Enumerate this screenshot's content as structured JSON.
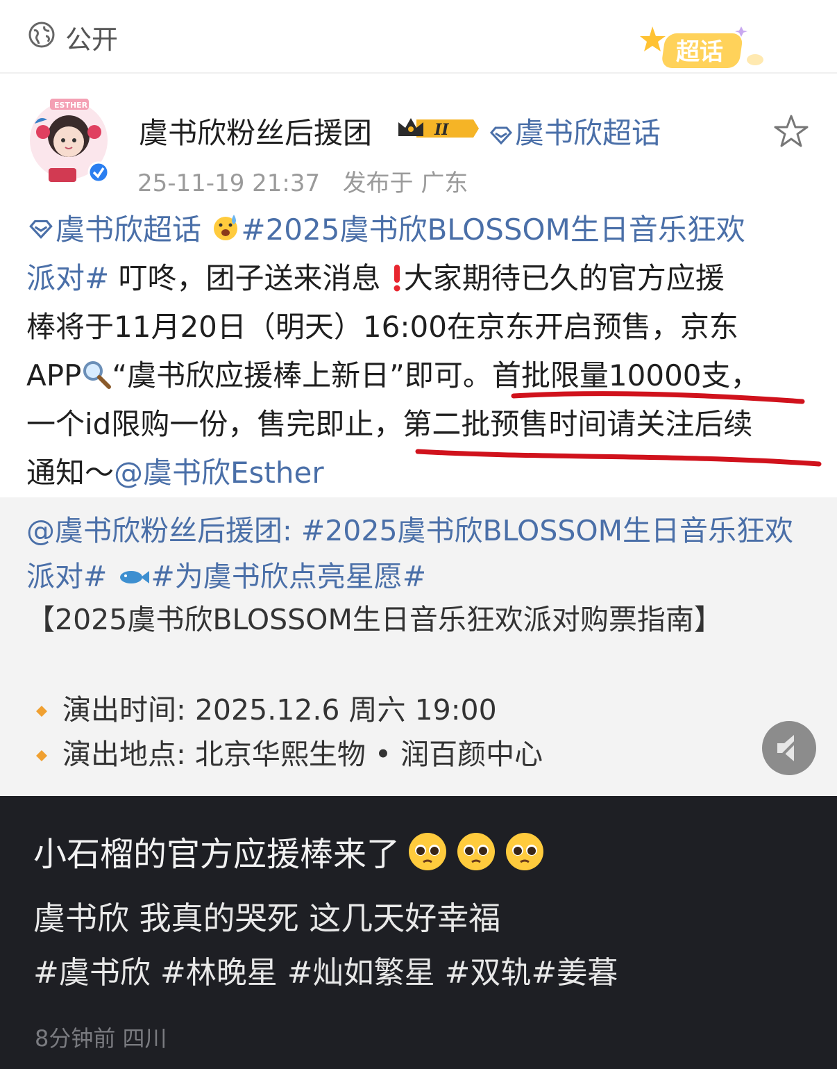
{
  "topbar": {
    "visibility": "公开",
    "badge_text": "超话"
  },
  "post": {
    "author": "虞书欣粉丝后援团",
    "level_badge": "II",
    "topic": "虞书欣超话",
    "timestamp": "25-11-19 21:37",
    "location": "发布于 广东",
    "avatar_text": "ESTHER",
    "body_lines": [
      {
        "a": "虞书欣超话",
        "b": "#2025虞书欣BLOSSOM生日音乐狂欢"
      },
      {
        "a": "派对#",
        "b": " 叮咚，团子送来消息",
        "c": "大家期待已久的官方应援"
      },
      {
        "a": "棒将于11月20日（明天）16:00在京东开启预售，京东"
      },
      {
        "a": "APP",
        "b": "“虞书欣应援棒上新日”即可。首批限量10000支，"
      },
      {
        "a": "一个id限购一份，售完即止，第二批预售时间请关注后续"
      },
      {
        "a": "通知～",
        "b": "@虞书欣Esther"
      }
    ]
  },
  "repost": {
    "line1": "@虞书欣粉丝后援团: #2025虞书欣BLOSSOM生日音乐狂欢",
    "line2_a": "派对#",
    "line2_b": "#为虞书欣点亮星愿#",
    "line3": "【2025虞书欣BLOSSOM生日音乐狂欢派对购票指南】",
    "bullets": [
      "演出时间: 2025.12.6 周六 19:00",
      "演出地点: 北京华熙生物 • 润百颜中心"
    ]
  },
  "comment": {
    "title": "小石榴的官方应援棒来了",
    "subtitle": "虞书欣 我真的哭死 这几天好幸福",
    "tags": "#虞书欣 #林晚星 #灿如繁星 #双轨#姜暮",
    "time_location": "8分钟前 四川"
  },
  "colors": {
    "link_blue": "#4a6fa8",
    "underline_red": "#d0121c",
    "dark_bg": "#1e1f24",
    "bullet_orange": "#f0a030"
  },
  "icons": [
    "globe-icon",
    "chaohua-badge-icon",
    "crown-badge-icon",
    "diamond-icon",
    "star-icon",
    "exclamation-icon",
    "search-icon",
    "fish-icon",
    "speaker-icon",
    "pleading-face-icon"
  ]
}
